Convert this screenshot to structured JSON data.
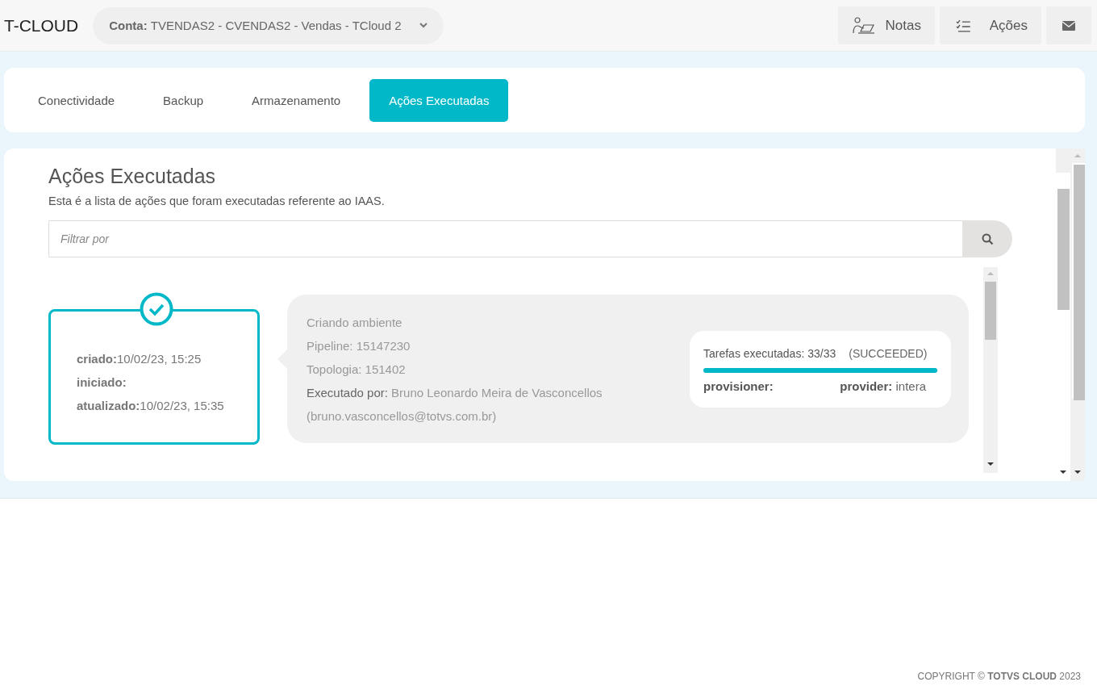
{
  "header": {
    "logo": "T-CLOUD",
    "account": {
      "label": "Conta:",
      "value": "TVENDAS2 - CVENDAS2 - Vendas - TCloud 2"
    },
    "buttons": [
      {
        "kind": "notes",
        "label": "Notas"
      },
      {
        "kind": "actions",
        "label": "Ações"
      },
      {
        "kind": "mail"
      }
    ]
  },
  "tabs": [
    {
      "label": "Conectividade",
      "selected": false
    },
    {
      "label": "Backup",
      "selected": false
    },
    {
      "label": "Armazenamento",
      "selected": false
    },
    {
      "label": "Ações Executadas",
      "selected": true
    }
  ],
  "section": {
    "title": "Ações Executadas",
    "description": "Esta é a lista de ações que foram executadas referente ao IAAS.",
    "search": {
      "placeholder": "Filtrar por"
    }
  },
  "actions": [
    {
      "completed": true,
      "dates": [
        {
          "label": "criado:",
          "value": "10/02/23, 15:25"
        },
        {
          "label": "iniciado:"
        },
        {
          "label": "atualizado:",
          "value": "10/02/23, 15:35"
        }
      ],
      "details": [
        "Criando ambiente",
        "Pipeline: 15147230",
        "Topologia: 151402"
      ],
      "executed_by": {
        "label": "Executado por:",
        "value": "Bruno Leonardo Meira de Vasconcellos",
        "email": "(bruno.vasconcellos@totvs.com.br)"
      },
      "tasks": {
        "label": "Tarefas executadas: 33/33",
        "status": "(SUCCEEDED)",
        "level": 1,
        "provisioner": {
          "label": "provisioner:"
        },
        "provider": {
          "label": "provider:",
          "value": "intera"
        }
      }
    }
  ],
  "footer": "COPYRIGHT © **TOTVS CLOUD** 2023"
}
